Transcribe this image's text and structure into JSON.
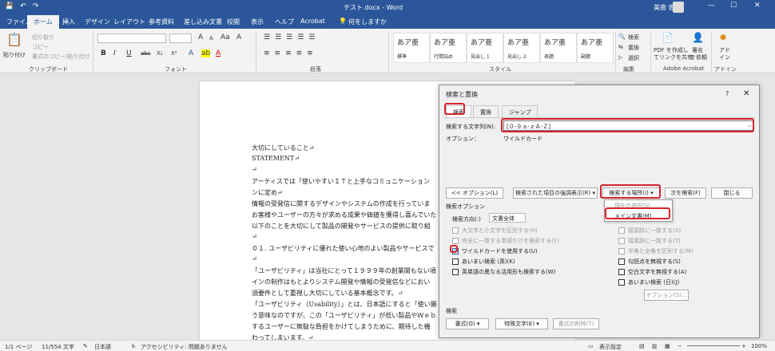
{
  "titlebar": {
    "doc_title": "テスト.docx  -  Word",
    "user": "美南 佐藤",
    "save_glyph": "💾",
    "undo_glyph": "↶",
    "redo_glyph": "↷",
    "min_glyph": "—",
    "max_glyph": "☐",
    "close_glyph": "✕"
  },
  "tabs": [
    "ファイル",
    "ホーム",
    "挿入",
    "デザイン",
    "レイアウト",
    "参考資料",
    "差し込み文書",
    "校閲",
    "表示",
    "ヘルプ",
    "Acrobat"
  ],
  "tellme": "何をしますか",
  "tellme_icon": "lightbulb-icon",
  "ribbon": {
    "clipboard": {
      "paste": "貼り付け",
      "cut": "切り取り",
      "copy": "コピー",
      "format_painter": "書式のコピー/貼り付け",
      "label": "クリップボード"
    },
    "font": {
      "label": "フォント",
      "bold": "B",
      "italic": "I",
      "underline": "U",
      "strike": "abc",
      "sub": "X₂",
      "sup": "X²",
      "grow": "A",
      "shrink": "A",
      "case": "Aa",
      "clear": "A",
      "color": "A"
    },
    "paragraph": {
      "label": "段落"
    },
    "styles": {
      "label": "スタイル",
      "items": [
        {
          "preview": "あア亜",
          "name": "標準"
        },
        {
          "preview": "あア亜",
          "name": "行間詰め"
        },
        {
          "preview": "あア亜",
          "name": "見出し 1"
        },
        {
          "preview": "あア亜",
          "name": "見出し 2"
        },
        {
          "preview": "あア亜",
          "name": "表題"
        },
        {
          "preview": "あア亜",
          "name": "副題"
        }
      ]
    },
    "editing": {
      "label": "編集",
      "find": "検索",
      "replace": "置換",
      "select": "選択"
    },
    "acrobat": {
      "label": "Adobe Acrobat",
      "create_pdf": "PDF を作成し",
      "create_pdf2": "てリンクを共有",
      "sign": "署名",
      "sign2": "を依頼"
    },
    "addins": {
      "label": "アドイン",
      "addin": "アド",
      "addin2": "イン"
    }
  },
  "document": {
    "lines": [
      "大切にしていること↵",
      "STATEMENT↵",
      "↵",
      "アーティスでは「使いやすいＩＴと上手なコミュニケーション",
      "ンに定め↵",
      "情報の受発信に関するデザインやシステムの作成を行っていま",
      "お客様やユーザーの方々が求める成果や価値を獲得し喜んでいた",
      "以下のことを大切にして製品の開発やサービスの提供に取り組",
      "↵",
      "０１. ユーザビリティに優れた使い心地のよい製品やサービスで",
      "↵",
      "「ユーザビリティ」は当社にとって１９９９年の創業間もない頃",
      "インの制作はもとよりシステム開発や情報の受発信などにおい",
      "須要件として重視し大切にしている基本概念です。↵",
      "「ユーザビリティ（Usability）」とは、日本語にすると「使い勝",
      "う意味なのですが、この「ユーザビリティ」が低い製品やＷｅｂ",
      "するユーザーに無駄な負担をかけてしまうために、期待した機",
      "わってしまいます。↵"
    ]
  },
  "dialog": {
    "title": "検索と置換",
    "help": "?",
    "close": "✕",
    "tabs": [
      "検索",
      "置換",
      "ジャンプ"
    ],
    "find_label": "検索する文字列(N):",
    "find_value": "[０-９ａ-ｚＡ-Ｚ]",
    "options_label": "オプション：",
    "options_value": "ワイルドカード",
    "btn_options": "<< オプション(L)",
    "btn_highlight": "検索された項目の強調表示(R) ▾",
    "btn_find_in": "検索する場所(I) ▾",
    "btn_find_next": "次を検索(F)",
    "btn_close": "閉じる",
    "search_options_title": "検索オプション",
    "direction_label": "検索方向(:)",
    "direction_value": "文書全体",
    "left_options": [
      {
        "label": "大文字と小文字を区別する(H)",
        "checked": false,
        "enabled": false
      },
      {
        "label": "完全に一致する単語だけを検索する(Y)",
        "checked": false,
        "enabled": false
      },
      {
        "label": "ワイルドカードを使用する(U)",
        "checked": true,
        "enabled": true
      },
      {
        "label": "あいまい検索 (英)(K)",
        "checked": false,
        "enabled": true
      },
      {
        "label": "英単語の異なる活用形も検索する(W)",
        "checked": false,
        "enabled": true
      }
    ],
    "right_options": [
      {
        "label": "接頭辞に一致する(X)",
        "checked": false,
        "enabled": false
      },
      {
        "label": "接尾辞に一致する(T)",
        "checked": false,
        "enabled": false
      },
      {
        "label": "半角と全角を区別する(M)",
        "checked": false,
        "enabled": false
      },
      {
        "label": "句読点を無視する(S)",
        "checked": false,
        "enabled": true
      },
      {
        "label": "空白文字を無視する(A)",
        "checked": false,
        "enabled": true
      },
      {
        "label": "あいまい検索 (日)(J)",
        "checked": false,
        "enabled": true
      }
    ],
    "btn_fuzzy_options": "オプション(S)...",
    "search_section": "検索",
    "btn_format": "書式(O) ▾",
    "btn_special": "特殊文字(E) ▾",
    "btn_no_format": "書式の削除(T)",
    "menu": {
      "current_selection": "現在の選択(S)",
      "main_document": "メイン文書(M)"
    }
  },
  "status": {
    "page": "1/1 ページ",
    "words": "11/554 文字",
    "language": "日本語",
    "accessibility": "アクセシビリティ: 問題ありません",
    "display": "表示設定",
    "zoom": "100%"
  },
  "colors": {
    "accent": "#2b579a",
    "highlight": "#d6242e"
  }
}
